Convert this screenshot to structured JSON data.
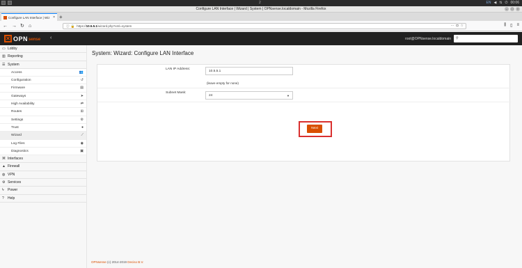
{
  "os": {
    "workspace_label": "2",
    "lang": "EN",
    "clock": "00:06"
  },
  "window": {
    "title": "Configure LAN Interface | Wizard | System | OPNsense.localdomain - Mozilla Firefox"
  },
  "browser": {
    "tab_label": "Configure LAN Interface | Wiz",
    "url_prefix": "https://",
    "url_host": "10.5.5.1",
    "url_path": "/wizard.php?xml=system"
  },
  "header": {
    "logo_opn": "OPN",
    "logo_sense": "sense",
    "user_host": "root@OPNsense.localdomain"
  },
  "sidebar": {
    "top_items": [
      {
        "label": "Lobby",
        "icon": "laptop-icon"
      },
      {
        "label": "Reporting",
        "icon": "chart-icon"
      },
      {
        "label": "System",
        "icon": "server-icon"
      }
    ],
    "system_items": [
      {
        "label": "Access",
        "icon": "users-icon"
      },
      {
        "label": "Configuration",
        "icon": "history-icon"
      },
      {
        "label": "Firmware",
        "icon": "file-icon"
      },
      {
        "label": "Gateways",
        "icon": "location-icon"
      },
      {
        "label": "High Availability",
        "icon": "refresh-icon"
      },
      {
        "label": "Routes",
        "icon": "map-signs-icon"
      },
      {
        "label": "Settings",
        "icon": "cogs-icon"
      },
      {
        "label": "Trust",
        "icon": "certificate-icon"
      },
      {
        "label": "Wizard",
        "icon": "magic-icon"
      },
      {
        "label": "Log Files",
        "icon": "eye-icon"
      },
      {
        "label": "Diagnostics",
        "icon": "medkit-icon"
      }
    ],
    "bottom_items": [
      {
        "label": "Interfaces",
        "icon": "sitemap-icon"
      },
      {
        "label": "Firewall",
        "icon": "fire-icon"
      },
      {
        "label": "VPN",
        "icon": "globe-icon"
      },
      {
        "label": "Services",
        "icon": "cog-icon"
      },
      {
        "label": "Power",
        "icon": "plug-icon"
      },
      {
        "label": "Help",
        "icon": "question-icon"
      }
    ]
  },
  "main": {
    "title": "System: Wizard: Configure LAN Interface",
    "lan_ip_label": "LAN IP Address:",
    "lan_ip_value": "10.5.5.1",
    "lan_ip_hint": "(leave empty for none)",
    "subnet_label": "Subnet Mask:",
    "subnet_value": "24",
    "next_label": "Next"
  },
  "footer": {
    "brand": "OPNsense",
    "text": " (c) 2014-2019 ",
    "company": "Deciso B.V."
  },
  "colors": {
    "accent": "#d94f00",
    "highlight": "#d9302f"
  }
}
